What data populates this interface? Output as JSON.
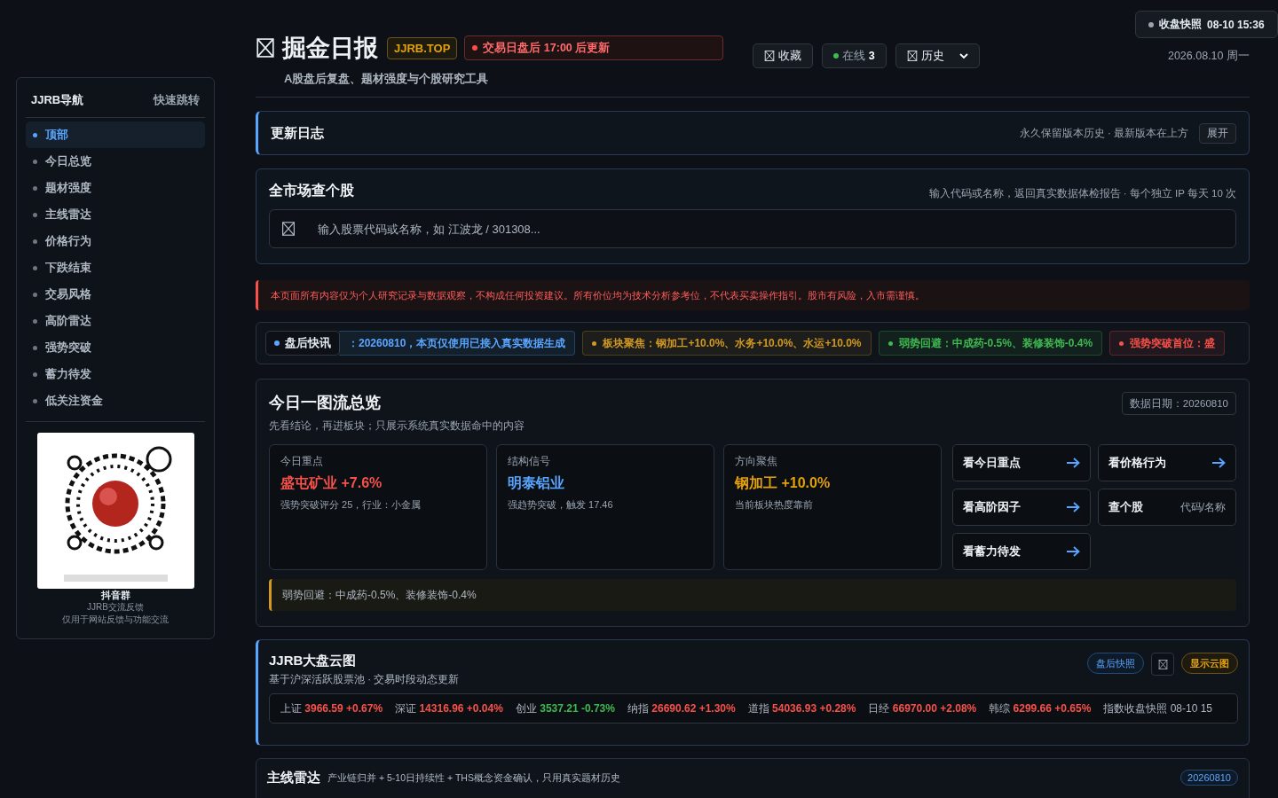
{
  "header": {
    "title": "掘金日报",
    "domain": "JJRB.TOP",
    "notice": "交易日盘后 17:00 后更新",
    "subtitle": "A股盘后复盘、题材强度与个股研究工具",
    "controls": [
      {
        "kind": "button",
        "label": "收藏"
      },
      {
        "kind": "online",
        "label": "在线",
        "count": "3"
      },
      {
        "kind": "select",
        "label": "历史"
      }
    ],
    "snapshot": {
      "label": "收盘快照",
      "time": "08-10 15:36"
    },
    "date": "2026.08.10 周一"
  },
  "sidebar": {
    "title": "JJRB导航",
    "action": "快速跳转",
    "items": [
      {
        "label": "顶部",
        "selected": true
      },
      {
        "label": "今日总览",
        "selected": false
      },
      {
        "label": "题材强度",
        "selected": false
      },
      {
        "label": "主线雷达",
        "selected": false
      },
      {
        "label": "价格行为",
        "selected": false
      },
      {
        "label": "下跌结束",
        "selected": false
      },
      {
        "label": "交易风格",
        "selected": false
      },
      {
        "label": "高阶雷达",
        "selected": false
      },
      {
        "label": "强势突破",
        "selected": false
      },
      {
        "label": "蓄力待发",
        "selected": false
      },
      {
        "label": "低关注资金",
        "selected": false
      }
    ],
    "qr": {
      "kind": "picture",
      "title": "抖音群",
      "lines": [
        "JJRB交流反馈",
        "仅用于网站反馈与功能交流"
      ]
    }
  },
  "changelog": {
    "title": "更新日志",
    "note": "永久保留版本历史 · 最新版本在上方",
    "action": "展开"
  },
  "search": {
    "title": "全市场查个股",
    "note": "输入代码或名称，返回真实数据体检报告 · 每个独立 IP 每天 10 次",
    "placeholder": "输入股票代码或名称，如 江波龙 / 301308..."
  },
  "disclaimer": "本页面所有内容仅为个人研究记录与数据观察，不构成任何投资建议。所有价位均为技术分析参考位，不代表买卖操作指引。股市有风险，入市需谨慎。",
  "ticker": {
    "label": "盘后快讯",
    "items": [
      {
        "text": "：20260810，本页仅使用已接入真实数据生成",
        "color": "#58a6ff",
        "dot": false
      },
      {
        "text": "板块聚焦：钢加工+10.0%、水务+10.0%、水运+10.0%",
        "color": "#d29922",
        "dot": true
      },
      {
        "text": "弱势回避：中成药-0.5%、装修装饰-0.4%",
        "color": "#3fb950",
        "dot": true
      },
      {
        "text": "强势突破首位：盛",
        "color": "#f85149",
        "dot": true
      }
    ]
  },
  "overview": {
    "title": "今日一图流总览",
    "subtitle": "先看结论，再进板块；只展示系统真实数据命中的内容",
    "date": "数据日期：20260810",
    "cards": [
      {
        "label": "今日重点",
        "value": "盛屯矿业 +7.6%",
        "color": "#f85149",
        "note": "强势突破评分 25，行业：小金属"
      },
      {
        "label": "结构信号",
        "value": "明泰铝业",
        "color": "#58a6ff",
        "note": "强趋势突破，触发 17.46"
      },
      {
        "label": "方向聚焦",
        "value": "钢加工 +10.0%",
        "color": "#e3a008",
        "note": "当前板块热度靠前"
      }
    ],
    "links": [
      {
        "kind": "arrow",
        "label": "看今日重点"
      },
      {
        "kind": "arrow",
        "label": "看价格行为"
      },
      {
        "kind": "arrow",
        "label": "看高阶因子"
      },
      {
        "kind": "hint",
        "label": "查个股",
        "hint": "代码/名称"
      },
      {
        "kind": "arrow",
        "label": "看蓄力待发"
      }
    ],
    "alert": "弱势回避：中成药-0.5%、装修装饰-0.4%"
  },
  "cloud": {
    "title": "JJRB大盘云图",
    "subtitle": "基于沪深活跃股票池 · 交易时段动态更新",
    "snapshot": "盘后快照",
    "toggle": "显示云图",
    "indices": [
      {
        "name": "上证",
        "value": "3966.59",
        "change": "+0.67%",
        "color": "#f85149"
      },
      {
        "name": "深证",
        "value": "14316.96",
        "change": "+0.04%",
        "color": "#f85149"
      },
      {
        "name": "创业",
        "value": "3537.21",
        "change": "-0.73%",
        "color": "#3fb950"
      },
      {
        "name": "纳指",
        "value": "26690.62",
        "change": "+1.30%",
        "color": "#f85149"
      },
      {
        "name": "道指",
        "value": "54036.93",
        "change": "+0.28%",
        "color": "#f85149"
      },
      {
        "name": "日经",
        "value": "66970.00",
        "change": "+2.08%",
        "color": "#f85149"
      },
      {
        "name": "韩综",
        "value": "6299.66",
        "change": "+0.65%",
        "color": "#f85149"
      }
    ],
    "footer": "指数收盘快照 08-10 15"
  },
  "radar": {
    "title": "主线雷达",
    "subtitle": "产业链归并 + 5-10日持续性 + THS概念资金确认，只用真实题材历史",
    "badge": "20260810"
  }
}
